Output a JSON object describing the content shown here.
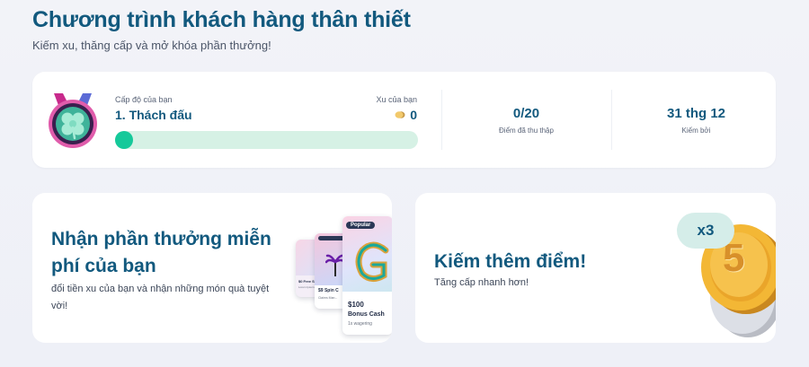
{
  "header": {
    "title": "Chương trình khách hàng thân thiết",
    "subtitle": "Kiếm xu, thăng cấp và mở khóa phần thưởng!"
  },
  "status": {
    "level_label": "Cấp độ của bạn",
    "level_name": "1. Thách đấu",
    "coins_label": "Xu của bạn",
    "coins_value": "0",
    "progress_fraction": 0.0,
    "points_value": "0/20",
    "points_label": "Điểm đã thu thập",
    "earned_value": "31 thg 12",
    "earned_label": "Kiếm bởi",
    "medal_icon": "clover-medal-icon"
  },
  "promo_rewards": {
    "title": "Nhận phần thưởng miễn phí của bạn",
    "description": "đổi tiền xu của bạn và nhận những món quà tuyệt vời!",
    "cards": {
      "front_badge": "Popular",
      "front_amount": "$100",
      "front_name": "Bonus Cash",
      "front_sub": "1x wagering",
      "middle_title": "$9 Spin C",
      "middle_sub": "Claims Man...",
      "back_title": "$0 Free Sp...",
      "back_sub": "Lorem Ipsum..."
    }
  },
  "promo_points": {
    "title": "Kiếm thêm điểm!",
    "description": "Tăng cấp nhanh hơn!",
    "multiplier": "x3",
    "coin_number": "5"
  },
  "colors": {
    "title": "#12597e",
    "progress_track": "#d6f1e5",
    "progress_fill": "#15c99a",
    "badge_bg": "#d5ede9"
  }
}
